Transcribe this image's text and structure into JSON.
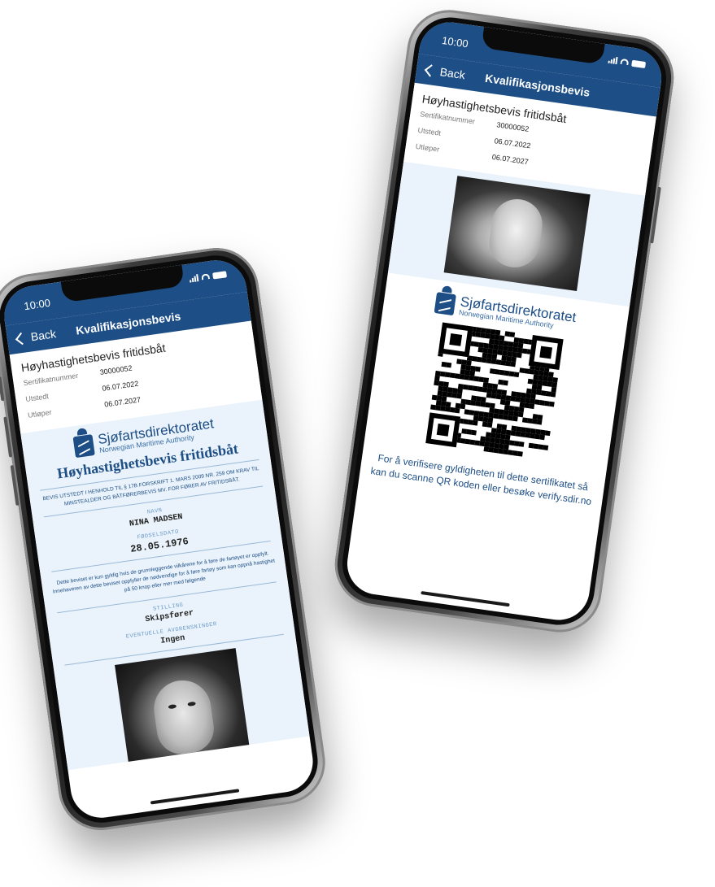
{
  "colors": {
    "brand": "#1d4e86",
    "panel": "#eaf3fb",
    "label": "#6b9bc9"
  },
  "status": {
    "time": "10:00"
  },
  "nav": {
    "back_label": "Back",
    "title": "Kvalifikasjonsbevis"
  },
  "certificate": {
    "name": "Høyhastighetsbevis fritidsbåt",
    "fields": [
      {
        "label": "Sertifikatnummer",
        "value": "30000052"
      },
      {
        "label": "Utstedt",
        "value": "06.07.2022"
      },
      {
        "label": "Utløper",
        "value": "06.07.2027"
      }
    ]
  },
  "authority": {
    "name": "Sjøfartsdirektoratet",
    "subtitle": "Norwegian Maritime Authority"
  },
  "document": {
    "heading": "Høyhastighetsbevis fritidsbåt",
    "legal": "BEVIS UTSTEDT I HENHOLD TIL § 17B FORSKRIFT 1. MARS 2009 NR. 259 OM KRAV TIL MINSTEALDER OG BÅTFØRERBEVIS MV. FOR FØRER AV FRITIDSBÅT.",
    "name_label": "NAVN",
    "name_value": "NINA MADSEN",
    "dob_label": "FØDSELSDATO",
    "dob_value": "28.05.1976",
    "validity_text": "Dette beviset er kun gyldig hvis de grunnleggende vilkårene for å føre de fartøyet er oppfylt. Innehaveren av dette beviset oppfyller de nødvendige for å føre fartøy som kan oppnå hastighet på 50 knop eller mer med følgende",
    "position_label": "STILLING",
    "position_value": "Skipsfører",
    "limits_label": "EVENTUELLE AVGRENSNINGER",
    "limits_value": "Ingen"
  },
  "verify": {
    "text": "For å verifisere gyldigheten til dette sertifikatet så kan du scanne QR koden eller besøke verify.sdir.no"
  },
  "icons": [
    "chevron-left-icon",
    "signal-icon",
    "wifi-icon",
    "battery-icon",
    "authority-emblem-icon",
    "qr-code"
  ]
}
